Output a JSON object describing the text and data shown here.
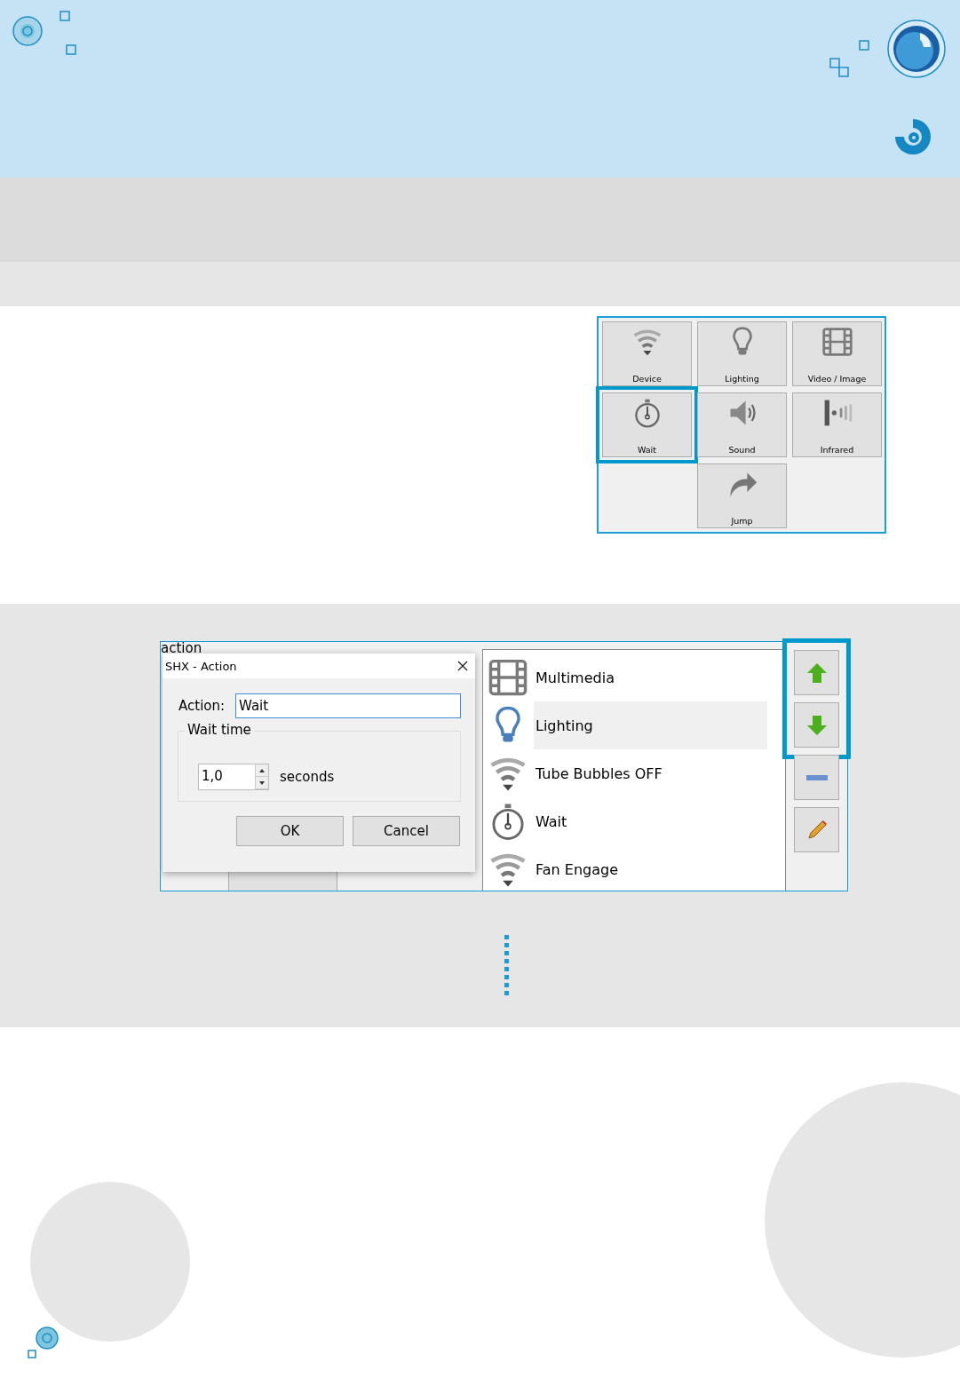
{
  "palette": {
    "items": [
      {
        "kind": "device",
        "label": "Device",
        "selected": false
      },
      {
        "kind": "lighting",
        "label": "Lighting",
        "selected": false
      },
      {
        "kind": "video",
        "label": "Video / Image",
        "selected": false
      },
      {
        "kind": "wait",
        "label": "Wait",
        "selected": true
      },
      {
        "kind": "sound",
        "label": "Sound",
        "selected": false
      },
      {
        "kind": "infrared",
        "label": "Infrared",
        "selected": false
      },
      {
        "kind": "jump",
        "label": "Jump",
        "selected": false
      }
    ]
  },
  "editor": {
    "background_label": "action",
    "dialog": {
      "title": "SHX - Action",
      "action_label": "Action:",
      "action_value": "Wait",
      "group_title": "Wait time",
      "wait_value": "1,0",
      "unit": "seconds",
      "buttons": [
        "OK",
        "Cancel"
      ]
    },
    "action_list": [
      {
        "kind": "video",
        "label": "Multimedia",
        "selected": false
      },
      {
        "kind": "lighting",
        "label": "Lighting",
        "selected": true
      },
      {
        "kind": "device",
        "label": "Tube Bubbles OFF",
        "selected": false
      },
      {
        "kind": "wait",
        "label": "Wait",
        "selected": false
      },
      {
        "kind": "device",
        "label": "Fan Engage",
        "selected": false
      }
    ],
    "side_buttons": [
      {
        "kind": "up",
        "highlighted": true
      },
      {
        "kind": "down",
        "highlighted": true
      },
      {
        "kind": "remove",
        "highlighted": false
      },
      {
        "kind": "edit",
        "highlighted": false
      }
    ]
  }
}
